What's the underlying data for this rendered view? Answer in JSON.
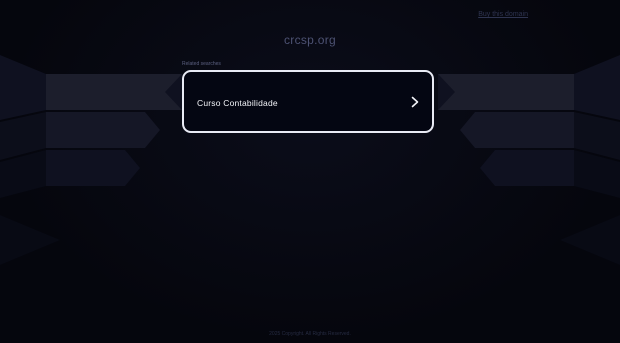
{
  "header": {
    "top_link_label": "Buy this domain"
  },
  "main": {
    "domain": "crcsp.org",
    "related_label": "Related searches",
    "results": [
      {
        "label": "Curso Contabilidade"
      }
    ]
  },
  "footer": {
    "text": "2025 Copyright. All Rights Reserved."
  },
  "colors": {
    "background": "#05060d",
    "card_border": "#e9ebf5",
    "card_text": "#f2f3f8",
    "title_text": "#4d5273"
  },
  "icons": {
    "result_arrow": "chevron-right-icon"
  }
}
